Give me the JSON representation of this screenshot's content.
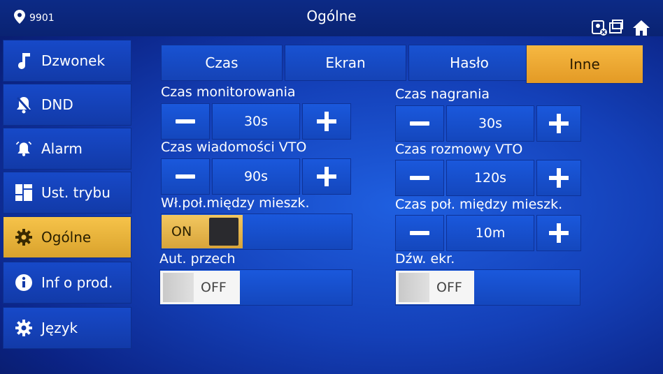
{
  "topbar": {
    "location": "9901",
    "title": "Ogólne"
  },
  "sidebar": {
    "items": [
      {
        "label": "Dzwonek",
        "icon": "music-note-icon"
      },
      {
        "label": "DND",
        "icon": "bell-off-icon"
      },
      {
        "label": "Alarm",
        "icon": "alarm-bell-icon"
      },
      {
        "label": "Ust. trybu",
        "icon": "grid-icon"
      },
      {
        "label": "Ogólne",
        "icon": "gear-icon",
        "active": true
      },
      {
        "label": "Inf o prod.",
        "icon": "info-icon"
      },
      {
        "label": "Język",
        "icon": "gear-icon"
      }
    ]
  },
  "tabs": [
    "Czas",
    "Ekran",
    "Hasło",
    "Inne"
  ],
  "active_tab": "Inne",
  "settings": {
    "monitor_label": "Czas monitorowania",
    "monitor_value": "30s",
    "record_label": "Czas nagrania",
    "record_value": "30s",
    "vto_msg_label": "Czas wiadomości VTO",
    "vto_msg_value": "90s",
    "vto_talk_label": "Czas rozmowy VTO",
    "vto_talk_value": "120s",
    "intercom_enable_label": "Wł.poł.między mieszk.",
    "intercom_enable_state": "ON",
    "intercom_time_label": "Czas poł. między mieszk.",
    "intercom_time_value": "10m",
    "auto_switch_label": "Aut. przech",
    "auto_switch_state": "OFF",
    "screen_sound_label": "Dźw. ekr.",
    "screen_sound_state": "OFF"
  },
  "colors": {
    "accent": "#f2b640",
    "background": "#1440b8"
  }
}
